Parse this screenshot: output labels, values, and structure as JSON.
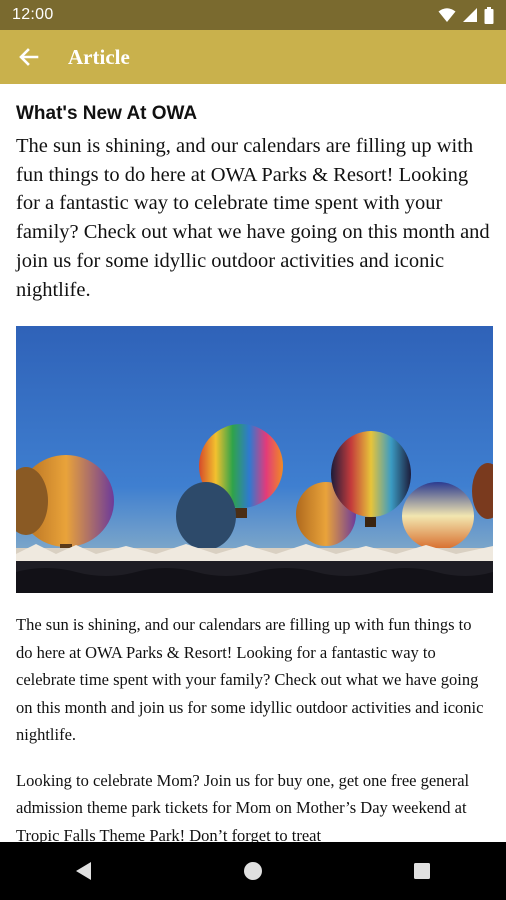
{
  "status_bar": {
    "time": "12:00"
  },
  "app_bar": {
    "title": "Article"
  },
  "article": {
    "title": "What's New At OWA",
    "lead": "The sun is shining, and our calendars are filling up with fun things to do here at OWA Parks & Resort! Looking for a fantastic way to celebrate time spent with your family? Check out what we have going on this month and join us for some idyllic outdoor activities and iconic nightlife.",
    "paragraphs": [
      "The sun is shining, and our calendars are filling up with fun things to do here at OWA Parks & Resort! Looking for a fantastic way to celebrate time spent with your family? Check out what we have going on this month and join us for some idyllic outdoor activities and iconic nightlife.",
      "Looking to celebrate Mom? Join us for buy one, get one free general admission theme park tickets for Mom on Mother’s Day weekend at Tropic Falls Theme Park! Don’t forget to treat"
    ]
  },
  "colors": {
    "status_bar": "#7a6a2f",
    "app_bar": "#c9b14c",
    "nav_bar": "#000000"
  },
  "icons": {
    "back": "arrow-left-icon",
    "wifi": "wifi-icon",
    "signal": "signal-icon",
    "battery": "battery-icon",
    "nav_back": "triangle-back-icon",
    "nav_home": "circle-home-icon",
    "nav_recents": "square-recents-icon"
  }
}
